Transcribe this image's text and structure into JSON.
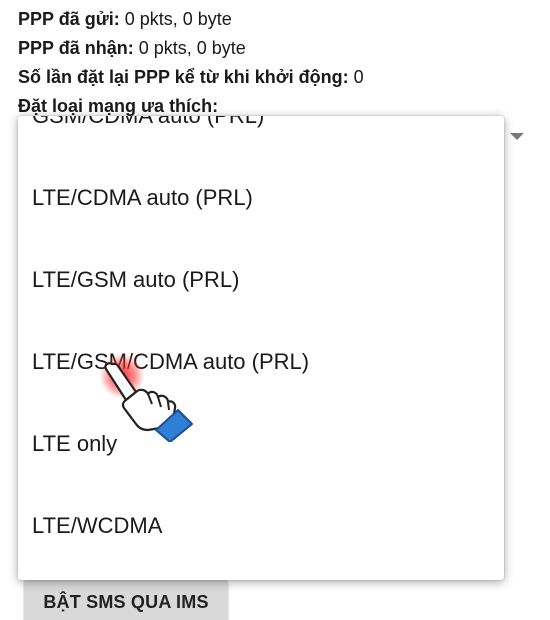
{
  "info": {
    "ppp_sent": {
      "label": "PPP đã gửi:",
      "value": "0 pkts, 0 byte"
    },
    "ppp_received": {
      "label": "PPP đã nhận:",
      "value": "0 pkts, 0 byte"
    },
    "ppp_resets": {
      "label": "Số lần đặt lại PPP kể từ khi khởi động:",
      "value": "0"
    },
    "preferred_network_label": "Đặt loại mạng ưa thích:"
  },
  "dropdown": {
    "options": [
      "GSM/CDMA auto (PRL)",
      "LTE/CDMA auto (PRL)",
      "LTE/GSM auto (PRL)",
      "LTE/GSM/CDMA auto (PRL)",
      "LTE only",
      "LTE/WCDMA"
    ]
  },
  "buttons": {
    "sms_over_ims": "BẬT SMS QUA IMS"
  },
  "icons": {
    "dropdown_arrow": "chevron-down-icon",
    "pointer": "hand-pointer-icon"
  },
  "colors": {
    "tap_highlight": "#ff2828",
    "hand_cuff": "#2f7fd6"
  }
}
